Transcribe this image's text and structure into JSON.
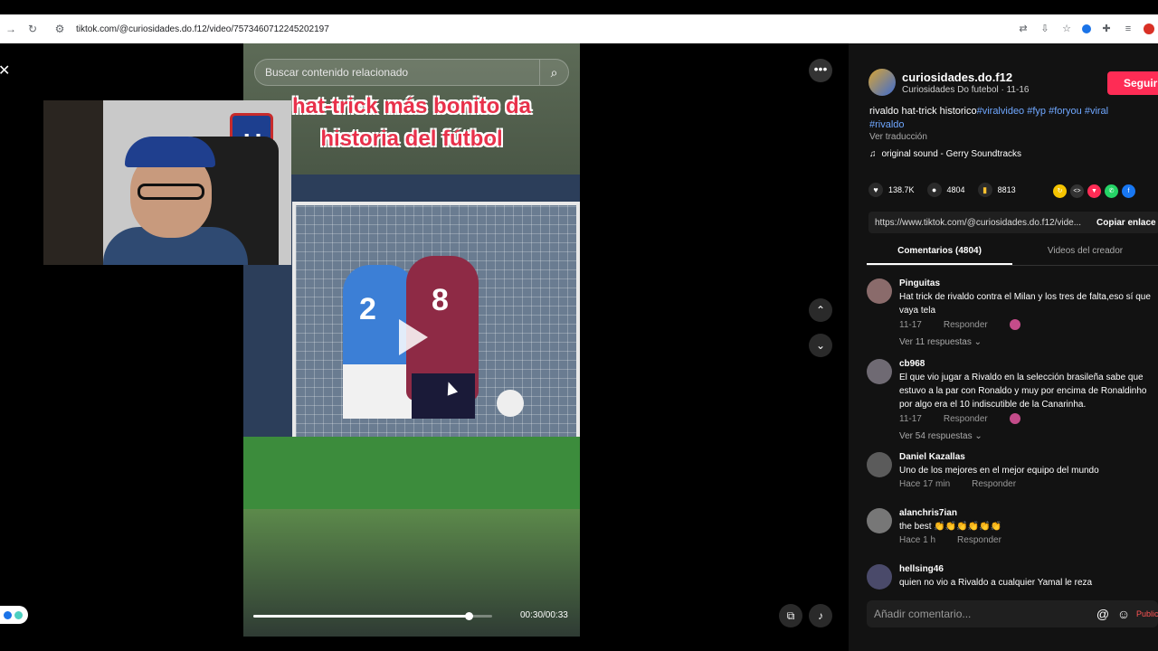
{
  "browser": {
    "url": "tiktok.com/@curiosidades.do.f12/video/7573460712245202197",
    "back_icon": "arrow-right-icon",
    "reload_icon": "reload-icon",
    "site_icon": "tune-icon"
  },
  "video": {
    "search_placeholder": "Buscar contenido relacionado",
    "caption_line1": "hat-trick más bonito da",
    "caption_line2": "historia del fútbol",
    "jersey_left": "2",
    "jersey_right": "8",
    "progress_fraction": 0.9,
    "time": "00:30/00:33"
  },
  "webcam": {
    "badge_letter": "U"
  },
  "author": {
    "name": "curiosidades.do.f12",
    "subtitle": "Curiosidades Do futebol · 11-16",
    "follow_label": "Seguir"
  },
  "description": {
    "text": "rivaldo hat-trick historico",
    "tags": "#viralvideo #fyp #foryou #viral #rivaldo",
    "translate": "Ver traducción",
    "sound": "original sound - Gerry Soundtracks"
  },
  "stats": {
    "likes": "138.7K",
    "comments": "4804",
    "saves": "8813"
  },
  "link": {
    "url": "https://www.tiktok.com/@curiosidades.do.f12/vide...",
    "copy_label": "Copiar enlace"
  },
  "tabs": {
    "comments": "Comentarios (4804)",
    "creator_videos": "Videos del creador"
  },
  "comments": [
    {
      "user": "Pinguitas",
      "text": "Hat trick de rivaldo contra el Milan y los tres de falta,eso sí que vaya tela",
      "date": "11-17",
      "reply": "Responder",
      "replies": "Ver 11 respuestas ⌄"
    },
    {
      "user": "cb968",
      "text": "El que vio jugar a Rivaldo en la selección brasileña sabe que estuvo a la par con Ronaldo y muy por encima de Ronaldinho por algo era el 10 indiscutible de la Canarinha.",
      "date": "11-17",
      "reply": "Responder",
      "replies": "Ver 54 respuestas ⌄"
    },
    {
      "user": "Daniel Kazallas",
      "text": "Uno de los mejores en el mejor equipo del mundo",
      "date": "Hace 17 min",
      "reply": "Responder"
    },
    {
      "user": "alanchris7ian",
      "text": "the best 👏👏👏👏👏👏",
      "date": "Hace 1 h",
      "reply": "Responder"
    },
    {
      "user": "hellsing46",
      "text": "quien no vio a Rivaldo a cualquier Yamal le reza"
    }
  ],
  "comment_input": {
    "placeholder": "Añadir comentario...",
    "post_label": "Publicar"
  },
  "colors": {
    "accent": "#fe2c55",
    "tag": "#6fa7ff"
  }
}
